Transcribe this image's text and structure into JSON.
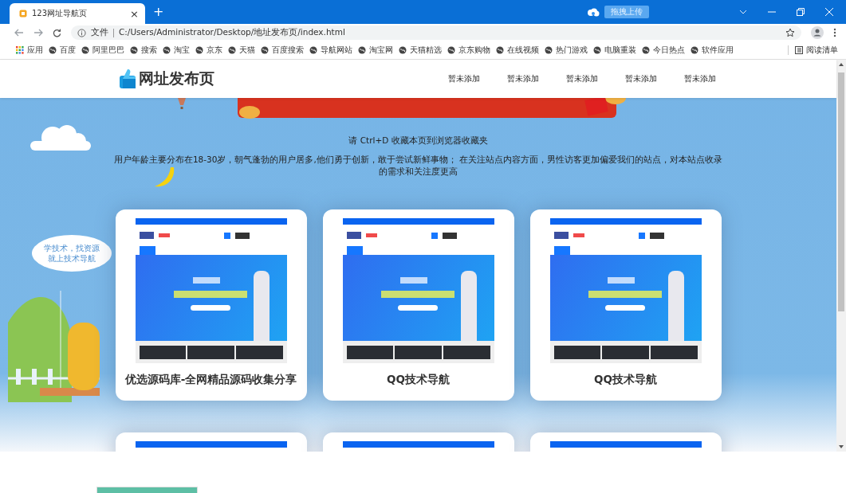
{
  "browser": {
    "tabs": [
      {
        "title": "123网址导航页",
        "close": "×",
        "selected": true
      }
    ],
    "new_tab": "+",
    "upload_button": "拖拽上传",
    "address": {
      "scheme": "文件",
      "url": "C:/Users/Administrator/Desktop/地址发布页/index.html"
    },
    "bookmarks": [
      {
        "kind": "apps",
        "label": "应用"
      },
      {
        "kind": "site",
        "label": "百度"
      },
      {
        "kind": "site",
        "label": "阿里巴巴"
      },
      {
        "kind": "site",
        "label": "搜索"
      },
      {
        "kind": "site",
        "label": "淘宝"
      },
      {
        "kind": "site",
        "label": "京东"
      },
      {
        "kind": "site",
        "label": "天猫"
      },
      {
        "kind": "site",
        "label": "百度搜索"
      },
      {
        "kind": "site",
        "label": "导航网站"
      },
      {
        "kind": "site",
        "label": "淘宝网"
      },
      {
        "kind": "site",
        "label": "天猫精选"
      },
      {
        "kind": "site",
        "label": "京东购物"
      },
      {
        "kind": "site",
        "label": "在线视频"
      },
      {
        "kind": "site",
        "label": "热门游戏"
      },
      {
        "kind": "site",
        "label": "电脑重装"
      },
      {
        "kind": "site",
        "label": "今日热点"
      },
      {
        "kind": "site",
        "label": "软件应用"
      }
    ],
    "reading_list": "阅读清单"
  },
  "page": {
    "logo": "网址发布页",
    "nav": [
      "暂未添加",
      "暂未添加",
      "暂未添加",
      "暂未添加",
      "暂未添加"
    ],
    "notice": "请 Ctrl+D 收藏本页到浏览器收藏夹",
    "description": "用户年龄主要分布在18-30岁，朝气蓬勃的用户居多,他们勇于创新，敢于尝试新鲜事物； 在关注站点内容方面，男性访客更加偏爱我们的站点，对本站点收录的需求和关注度更高",
    "speech_bubble": [
      "学技术，找资源",
      "就上技术导航"
    ],
    "cards": [
      {
        "kind": "full",
        "title": "优选源码库-全网精品源码收集分享"
      },
      {
        "kind": "full",
        "title": "QQ技术导航"
      },
      {
        "kind": "full",
        "title": "QQ技术导航"
      },
      {
        "kind": "cut"
      },
      {
        "kind": "cut"
      },
      {
        "kind": "cut"
      }
    ]
  }
}
